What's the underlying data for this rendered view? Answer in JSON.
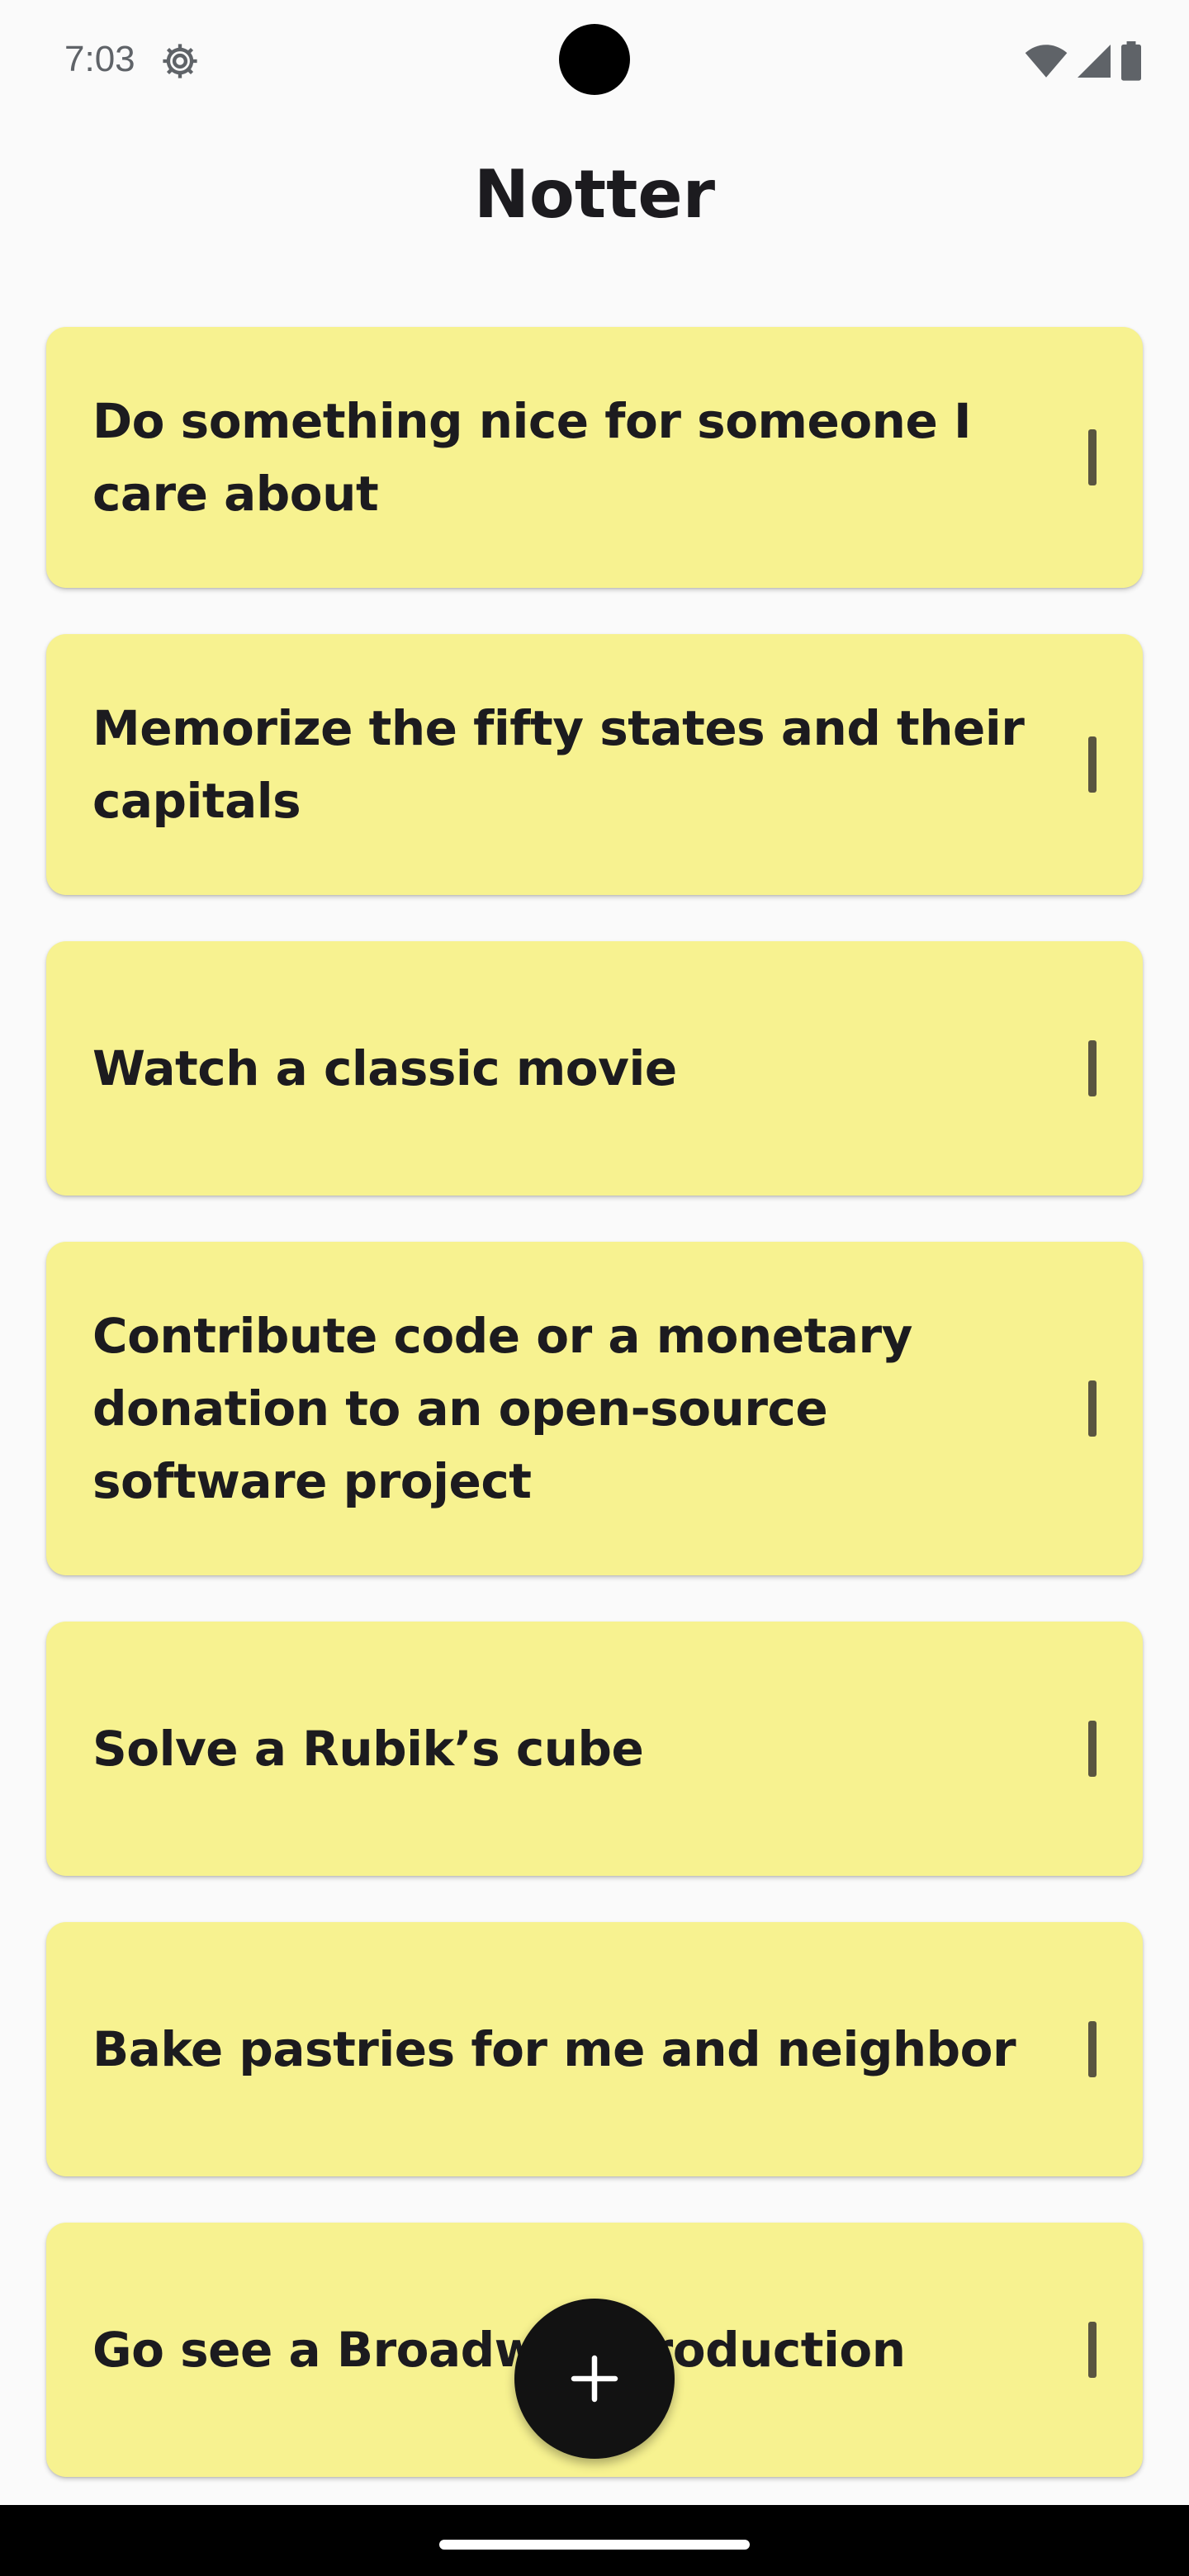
{
  "status_bar": {
    "time": "7:03",
    "icons": [
      "settings-gear-icon",
      "wifi-icon",
      "signal-icon",
      "battery-icon"
    ]
  },
  "app": {
    "title": "Notter"
  },
  "notes": [
    {
      "text": "Do something nice for someone I care about"
    },
    {
      "text": "Memorize the fifty states and their capitals"
    },
    {
      "text": "Watch a classic movie"
    },
    {
      "text": "Contribute code or a monetary donation to an open-source software project"
    },
    {
      "text": "Solve a Rubik’s cube"
    },
    {
      "text": "Bake pastries for me and neighbor"
    },
    {
      "text": "Go see a Broadway production"
    }
  ],
  "fab": {
    "icon": "plus-icon"
  },
  "colors": {
    "background": "#fafafa",
    "card": "#f7f290",
    "fab": "#121212",
    "text": "#1c1b1f"
  }
}
